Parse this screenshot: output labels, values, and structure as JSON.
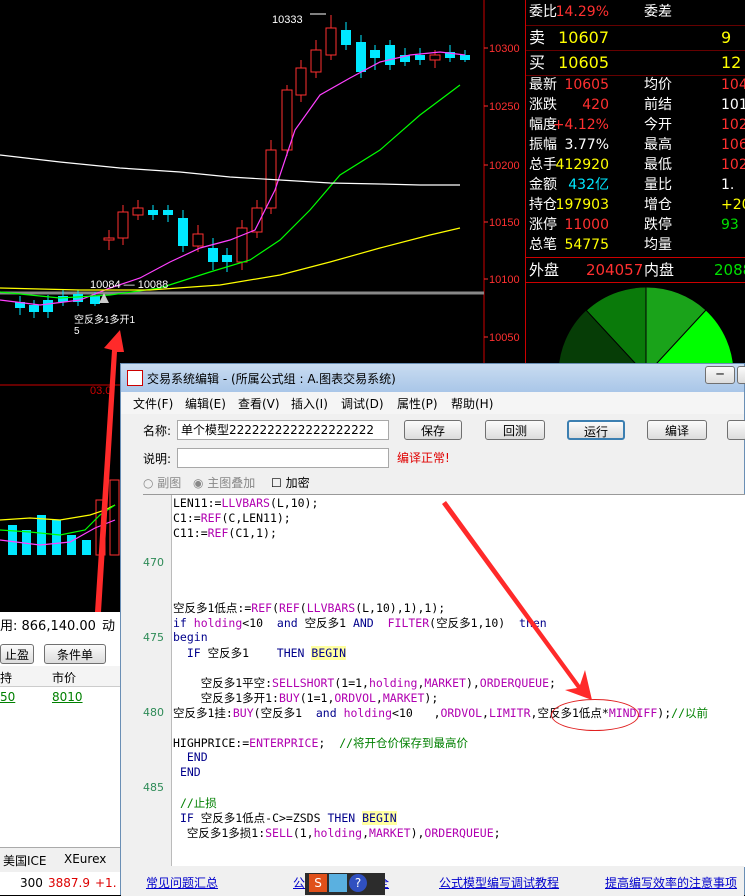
{
  "chart": {
    "price_labels": [
      "10300",
      "10250",
      "10200",
      "10150",
      "10100",
      "10050"
    ],
    "high_label": "10333",
    "low_label": "10084 — 10088",
    "signal_text": "空反多1多开1",
    "signal_sub": "5",
    "sub_label": "03.0",
    "colors": {
      "bull": "#ff3030",
      "bear": "#00e8ff",
      "ma1": "#ff40ff",
      "ma2": "#00ff00",
      "ma3": "#ffff00",
      "ma4": "#ffffff"
    }
  },
  "quote": {
    "rows": [
      {
        "l1": "委比",
        "v1": "14.29%",
        "c1": "red",
        "l2": "委差",
        "v2": "",
        "c2": "red"
      },
      {
        "l1": "卖",
        "v1": "10607",
        "c1": "yel",
        "l2": "",
        "v2": "9",
        "c2": "yel"
      },
      {
        "l1": "买",
        "v1": "10605",
        "c1": "yel",
        "l2": "",
        "v2": "12",
        "c2": "yel"
      },
      {
        "l1": "最新",
        "v1": "10605",
        "c1": "red",
        "l2": "均价",
        "v2": "104",
        "c2": "red"
      },
      {
        "l1": "涨跌",
        "v1": "420",
        "c1": "red",
        "l2": "前结",
        "v2": "101",
        "c2": "wht"
      },
      {
        "l1": "幅度",
        "v1": "+4.12%",
        "c1": "red",
        "l2": "今开",
        "v2": "102",
        "c2": "red"
      },
      {
        "l1": "振幅",
        "v1": "3.77%",
        "c1": "wht",
        "l2": "最高",
        "v2": "106",
        "c2": "red"
      },
      {
        "l1": "总手",
        "v1": "412920",
        "c1": "yel",
        "l2": "最低",
        "v2": "102",
        "c2": "red"
      },
      {
        "l1": "金额",
        "v1": "432亿",
        "c1": "cyn",
        "l2": "量比",
        "v2": "1.",
        "c2": "wht"
      },
      {
        "l1": "持仓",
        "v1": "197903",
        "c1": "yel",
        "l2": "增仓",
        "v2": "+205",
        "c2": "yel"
      },
      {
        "l1": "涨停",
        "v1": "11000",
        "c1": "red",
        "l2": "跌停",
        "v2": "93",
        "c2": "grn"
      },
      {
        "l1": "总笔",
        "v1": "54775",
        "c1": "yel",
        "l2": "均量",
        "v2": "",
        "c2": "yel"
      }
    ],
    "outer_label": "外盘",
    "outer_value": "204057",
    "inner_label": "内盘",
    "inner_value": "2088"
  },
  "dialog": {
    "title": "交易系统编辑 - (所属公式组 : A.图表交易系统)",
    "menus": [
      "文件(F)",
      "编辑(E)",
      "查看(V)",
      "插入(I)",
      "调试(D)",
      "属性(P)",
      "帮助(H)"
    ],
    "name_label": "名称:",
    "name_value": "单个模型2222222222222222222",
    "desc_label": "说明:",
    "desc_value": "",
    "status": "编译正常!",
    "buttons": {
      "save": "保存",
      "back": "回测",
      "run": "运行",
      "compile": "编译"
    },
    "radio1": "副图",
    "radio2": "主图叠加",
    "checkbox": "加密",
    "line_numbers": [
      {
        "n": "470",
        "row": 4
      },
      {
        "n": "475",
        "row": 9
      },
      {
        "n": "480",
        "row": 14
      },
      {
        "n": "485",
        "row": 19
      }
    ],
    "footer_links": [
      "常见问题汇总",
      "公式编写实用大全",
      "公式模型编写调试教程",
      "提高编写效率的注意事项"
    ]
  },
  "left_panel": {
    "funds_text": "用: 866,140.00",
    "funds_action": "动",
    "btn_stop": "止盈",
    "btn_cond": "条件单",
    "col_hold": "持",
    "col_price": "市价",
    "row_hold": "50",
    "row_price": "8010",
    "tab1": "美国ICE",
    "tab2": "XEurex",
    "status_prefix": "300",
    "status_price": "3887.9",
    "status_change": "+1."
  }
}
